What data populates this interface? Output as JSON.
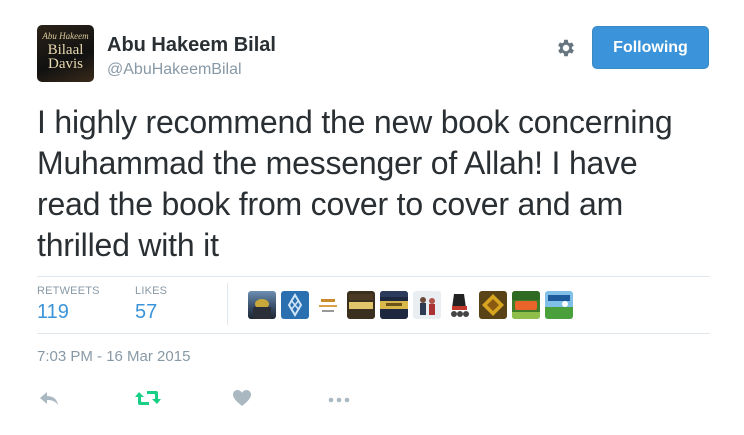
{
  "user": {
    "display_name": "Abu Hakeem Bilal",
    "handle": "@AbuHakeemBilal",
    "avatar_text": [
      "Abu Hakeem",
      "Bilaal",
      "Davis"
    ]
  },
  "follow_button": {
    "label": "Following"
  },
  "tweet": {
    "text": "I highly recommend the new book concerning Muhammad the messenger of Allah! I have read the book from cover to cover and am thrilled with it",
    "timestamp": "7:03 PM - 16 Mar 2015"
  },
  "stats": {
    "retweets": {
      "label": "RETWEETS",
      "value": "119"
    },
    "likes": {
      "label": "LIKES",
      "value": "57"
    }
  },
  "liker_avatars": [
    {
      "name": "liker-avatar-1",
      "icon": "mosque-photo"
    },
    {
      "name": "liker-avatar-2",
      "icon": "blue-calligraphy"
    },
    {
      "name": "liker-avatar-3",
      "icon": "light-logo"
    },
    {
      "name": "liker-avatar-4",
      "icon": "book-cover"
    },
    {
      "name": "liker-avatar-5",
      "icon": "book-cover-gold"
    },
    {
      "name": "liker-avatar-6",
      "icon": "people-photo"
    },
    {
      "name": "liker-avatar-7",
      "icon": "skates-photo"
    },
    {
      "name": "liker-avatar-8",
      "icon": "gold-emblem"
    },
    {
      "name": "liker-avatar-9",
      "icon": "green-banner"
    },
    {
      "name": "liker-avatar-10",
      "icon": "blue-green-banner"
    }
  ],
  "colors": {
    "accent": "#3b94d9",
    "retweet_green": "#19cf86",
    "muted": "#8899a6",
    "text": "#292f33"
  }
}
